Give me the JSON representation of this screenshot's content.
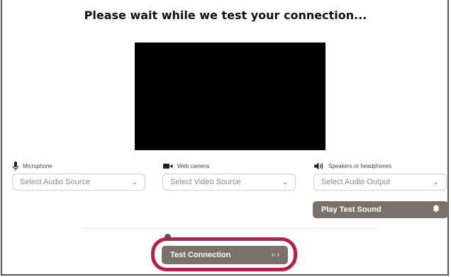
{
  "page": {
    "title": "Please wait while we test your connection..."
  },
  "devices": {
    "microphone": {
      "label": "Microphone",
      "placeholder": "Select Audio Source",
      "icon": "microphone-icon"
    },
    "camera": {
      "label": "Web camera",
      "placeholder": "Select Video Source",
      "icon": "video-camera-icon"
    },
    "speakers": {
      "label": "Speakers or headphones",
      "placeholder": "Select Audio Output",
      "icon": "speaker-icon"
    }
  },
  "buttons": {
    "play_test_sound": "Play Test Sound",
    "test_connection": "Test Connection",
    "test_connection_icon_glyph": "‹·›"
  },
  "colors": {
    "button_bg": "#7b716b",
    "highlight": "#b81f4c"
  }
}
